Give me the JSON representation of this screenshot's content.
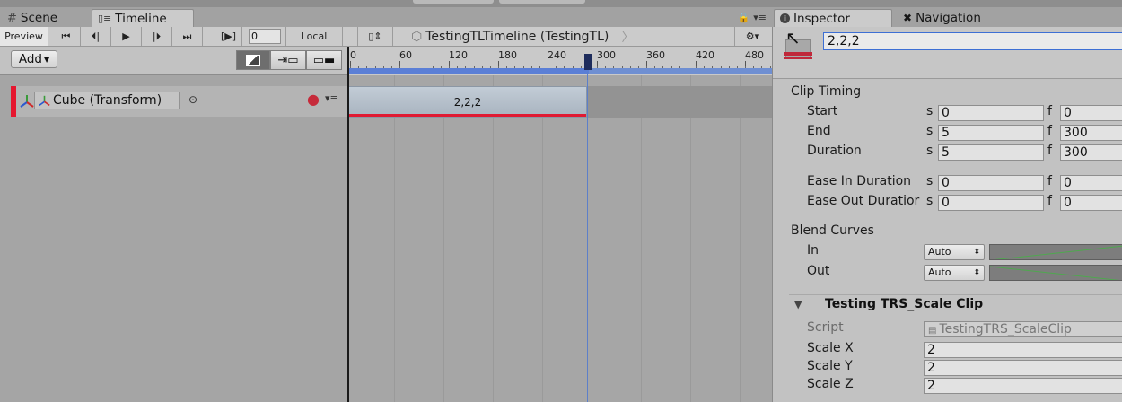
{
  "tabs": [
    {
      "label": "Scene",
      "icon": "grid-icon"
    },
    {
      "label": "Timeline",
      "icon": "timeline-icon"
    }
  ],
  "toolbar": {
    "preview_label": "Preview",
    "frame_value": "0",
    "local_label": "Local",
    "breadcrumb": "TestingTLTimeline (TestingTL)"
  },
  "controls": {
    "add_label": "Add"
  },
  "ruler": {
    "ticks": [
      "0",
      "60",
      "120",
      "180",
      "240",
      "300",
      "360",
      "420",
      "480"
    ]
  },
  "track": {
    "name": "Cube (Transform)"
  },
  "clip": {
    "label": "2,2,2"
  },
  "inspector": {
    "tabs": [
      {
        "label": "Inspector"
      },
      {
        "label": "Navigation"
      }
    ],
    "name_value": "2,2,2",
    "clip_timing": {
      "title": "Clip Timing",
      "rows": [
        {
          "label": "Start",
          "s": "0",
          "f": "0"
        },
        {
          "label": "End",
          "s": "5",
          "f": "300"
        },
        {
          "label": "Duration",
          "s": "5",
          "f": "300"
        },
        {
          "label": "Ease In Duration",
          "s": "0",
          "f": "0"
        },
        {
          "label": "Ease Out Duratior",
          "s": "0",
          "f": "0"
        }
      ],
      "s_unit": "s",
      "f_unit": "f"
    },
    "blend_curves": {
      "title": "Blend Curves",
      "in_label": "In",
      "out_label": "Out",
      "in_mode": "Auto",
      "out_mode": "Auto"
    },
    "clip_section": {
      "title": "Testing TRS_Scale Clip",
      "script_label": "Script",
      "script_value": "TestingTRS_ScaleClip",
      "fields": [
        {
          "label": "Scale X",
          "value": "2"
        },
        {
          "label": "Scale Y",
          "value": "2"
        },
        {
          "label": "Scale Z",
          "value": "2"
        }
      ]
    }
  },
  "colors": {
    "accent": "#e5172f",
    "selection": "#3d6fd4",
    "ruler_blue": "#5b7fd6"
  }
}
